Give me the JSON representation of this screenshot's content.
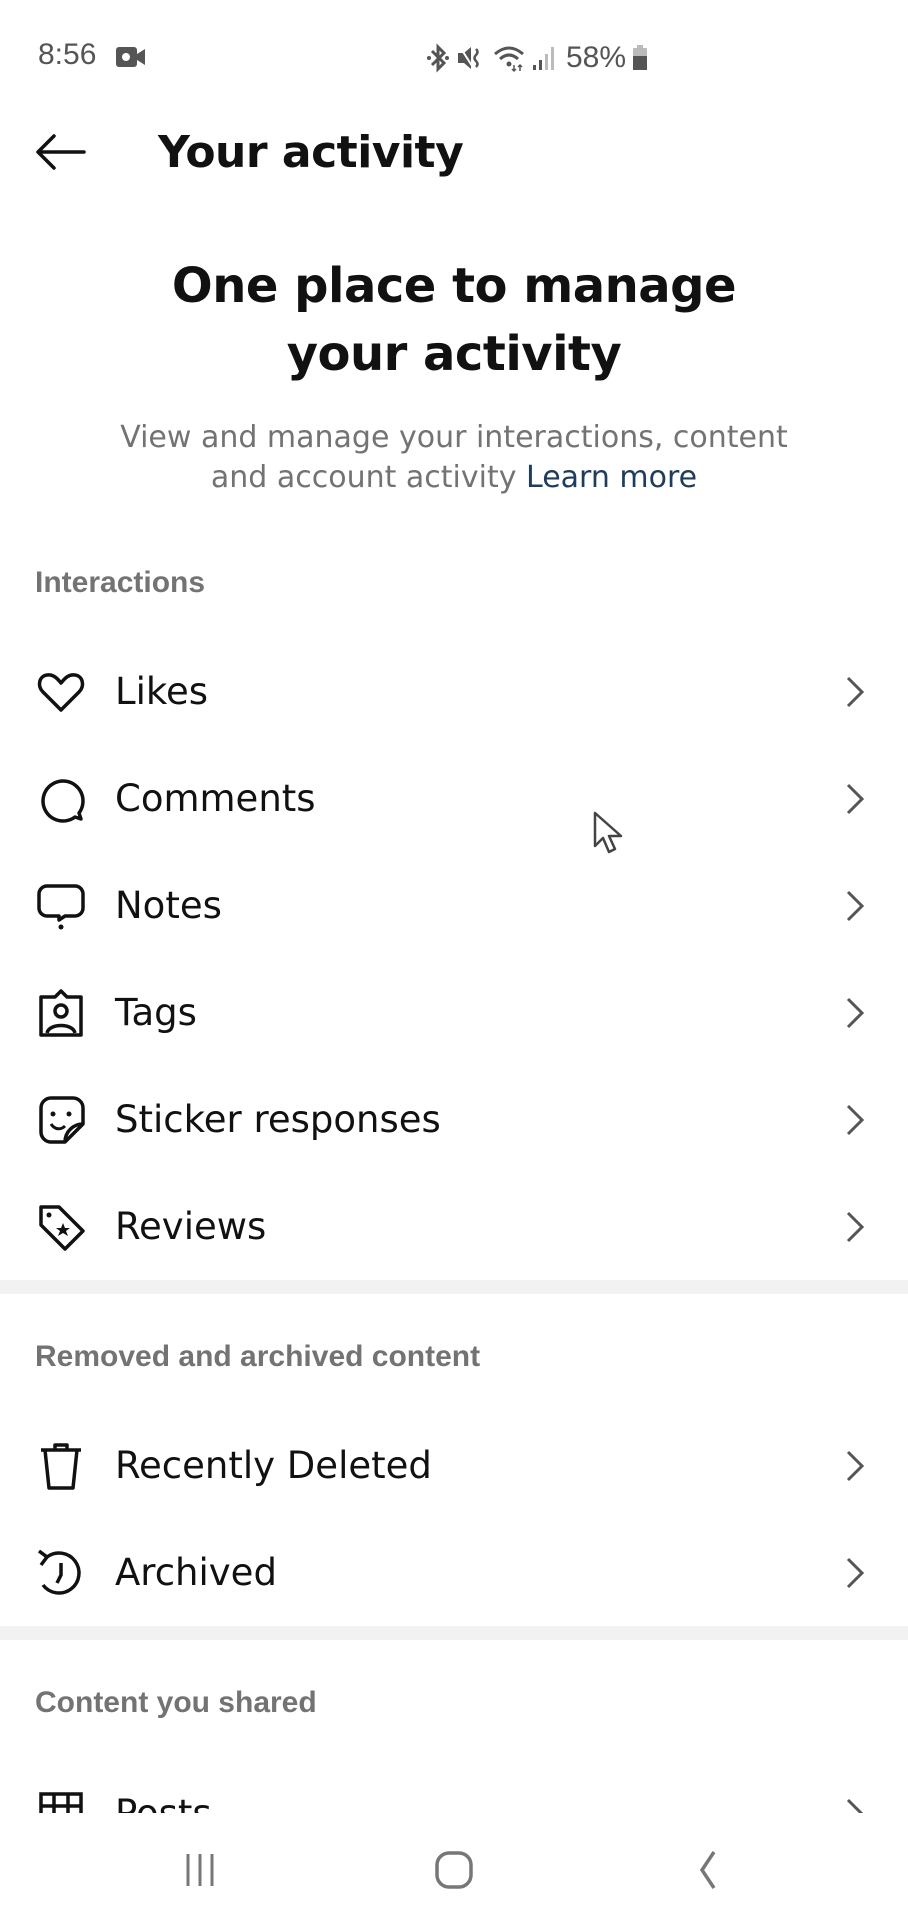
{
  "status_bar": {
    "time": "8:56",
    "battery": "58%",
    "icons": [
      "video-record-icon",
      "bluetooth-icon",
      "mute-icon",
      "wifi-icon",
      "signal-icon",
      "battery-icon"
    ]
  },
  "header": {
    "back_icon": "arrow-left-icon",
    "title": "Your activity"
  },
  "intro": {
    "heading": "One place to manage your activity",
    "subtitle": "View and manage your interactions, content and account activity",
    "learn_more": "Learn more",
    "link_color": "#1e3d5c"
  },
  "sections": [
    {
      "title": "Interactions",
      "items": [
        {
          "label": "Likes",
          "icon": "heart-icon"
        },
        {
          "label": "Comments",
          "icon": "comment-icon"
        },
        {
          "label": "Notes",
          "icon": "note-bubble-icon"
        },
        {
          "label": "Tags",
          "icon": "tag-person-icon"
        },
        {
          "label": "Sticker responses",
          "icon": "sticker-icon"
        },
        {
          "label": "Reviews",
          "icon": "review-tag-icon"
        }
      ]
    },
    {
      "title": "Removed and archived content",
      "items": [
        {
          "label": "Recently Deleted",
          "icon": "trash-icon"
        },
        {
          "label": "Archived",
          "icon": "archive-history-icon"
        }
      ]
    },
    {
      "title": "Content you shared",
      "items": [
        {
          "label": "Posts",
          "icon": "grid-icon"
        }
      ]
    }
  ],
  "nav_bar": {
    "recents": "recents-icon",
    "home": "home-icon",
    "back": "back-icon"
  },
  "colors": {
    "section_title": "#737373",
    "divider": "#f2f2f2",
    "text": "#111111"
  }
}
